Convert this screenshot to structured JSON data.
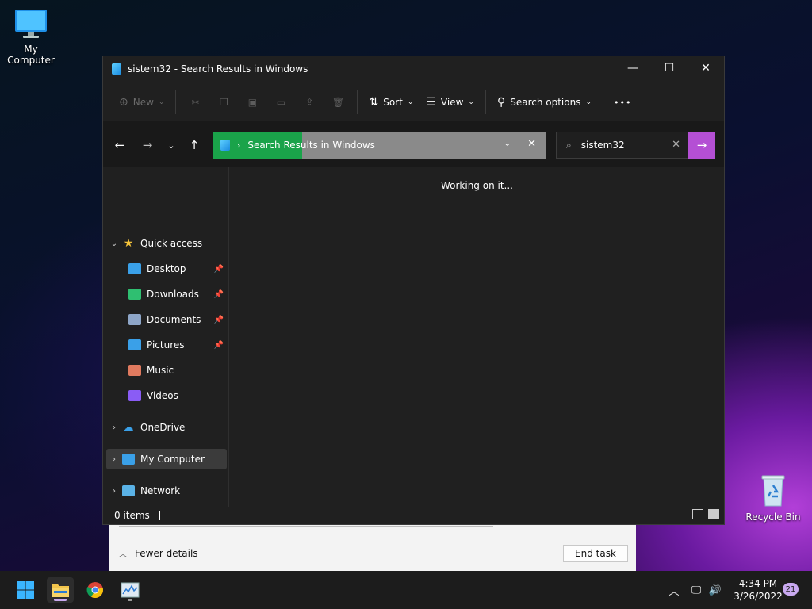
{
  "desktop": {
    "icons": [
      {
        "label": "My Computer",
        "icon": "monitor-icon"
      },
      {
        "label": "Recycle Bin",
        "icon": "recycle-bin-icon"
      }
    ]
  },
  "taskmgr": {
    "fewer_details_label": "Fewer details",
    "end_task_label": "End task"
  },
  "explorer": {
    "title": "sistem32 - Search Results in Windows",
    "window_buttons": {
      "minimize": "—",
      "maximize": "☐",
      "close": "✕"
    },
    "command_bar": {
      "new_label": "New",
      "sort_label": "Sort",
      "view_label": "View",
      "search_options_label": "Search options",
      "more_label": "•••"
    },
    "address": {
      "crumb": "Search Results in Windows",
      "progress_fraction": 0.27
    },
    "search": {
      "value": "sistem32"
    },
    "nav": {
      "quick_access": "Quick access",
      "items": [
        {
          "label": "Desktop",
          "pinned": true,
          "icon": "desktop-folder-icon",
          "color": "#3aa0e8"
        },
        {
          "label": "Downloads",
          "pinned": true,
          "icon": "download-icon",
          "color": "#2fbf71"
        },
        {
          "label": "Documents",
          "pinned": true,
          "icon": "document-icon",
          "color": "#8ea6c8"
        },
        {
          "label": "Pictures",
          "pinned": true,
          "icon": "pictures-icon",
          "color": "#3aa0e8"
        },
        {
          "label": "Music",
          "pinned": false,
          "icon": "music-icon",
          "color": "#e07a5f"
        },
        {
          "label": "Videos",
          "pinned": false,
          "icon": "videos-icon",
          "color": "#8a5cf5"
        }
      ],
      "onedrive": "OneDrive",
      "my_computer": "My Computer",
      "network": "Network"
    },
    "content": {
      "status_message": "Working on it..."
    },
    "statusbar": {
      "items_count": "0 items"
    }
  },
  "taskbar": {
    "clock_time": "4:34 PM",
    "clock_date": "3/26/2022",
    "notification_count": "21",
    "accent_color": "#c9a9f0"
  }
}
